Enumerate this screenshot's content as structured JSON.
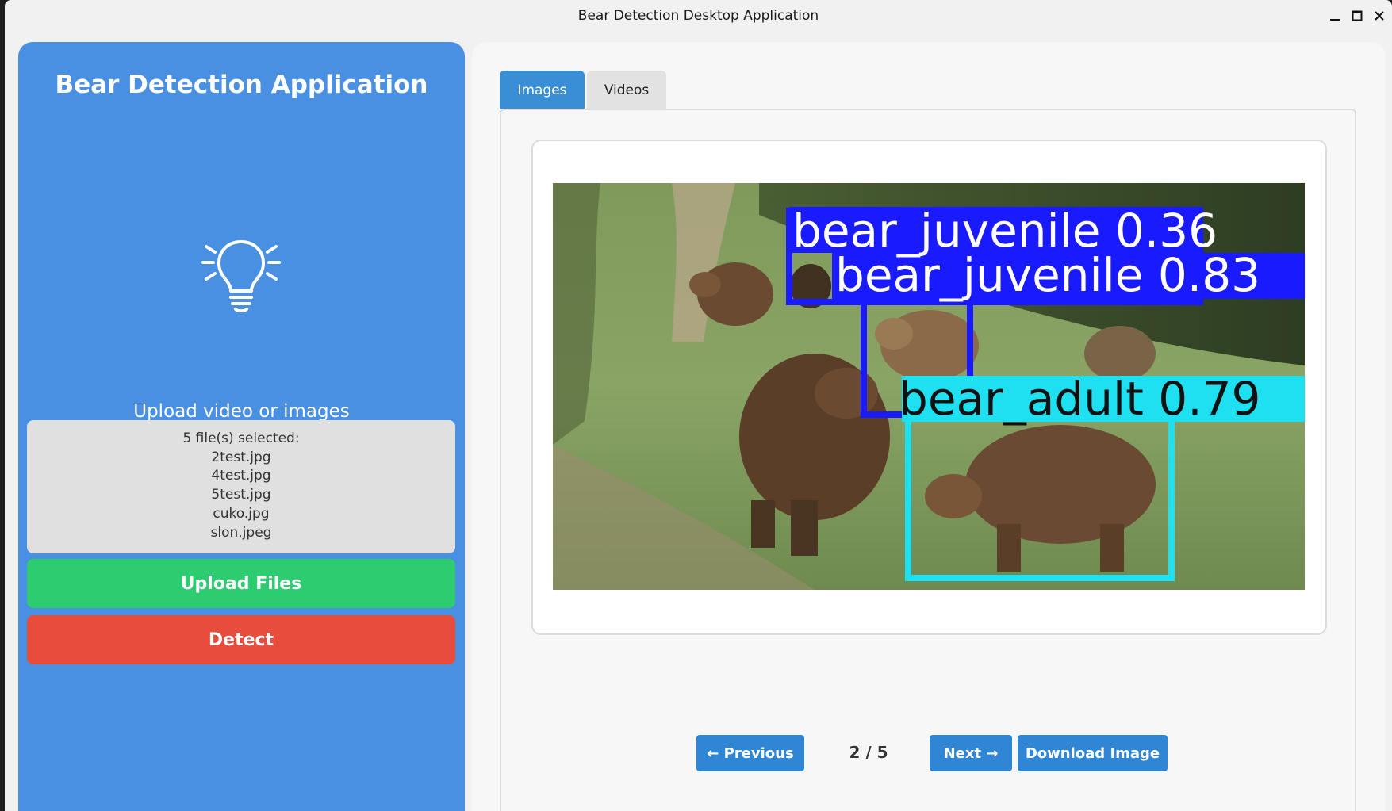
{
  "window": {
    "title": "Bear Detection Desktop Application"
  },
  "sidebar": {
    "heading": "Bear Detection Application",
    "icon": "lightbulb-icon",
    "upload_hint": "Upload video or images",
    "files": {
      "summary": "5 file(s) selected:",
      "names": [
        "2test.jpg",
        "4test.jpg",
        "5test.jpg",
        "cuko.jpg",
        "slon.jpeg"
      ]
    },
    "upload_button": "Upload Files",
    "detect_button": "Detect"
  },
  "tabs": [
    {
      "label": "Images",
      "active": true
    },
    {
      "label": "Videos",
      "active": false
    }
  ],
  "viewer": {
    "detections": [
      {
        "label": "bear_juvenile 0.36",
        "color": "#1a1aff"
      },
      {
        "label": "bear_juvenile 0.83",
        "color": "#1a1aff"
      },
      {
        "label": "bear_adult 0.79",
        "color": "#1ee0f0"
      }
    ],
    "prev_button": "← Previous",
    "page_counter": "2 / 5",
    "next_button": "Next →",
    "download_button": "Download Image"
  },
  "colors": {
    "sidebar": "#4a90e2",
    "upload": "#2ecc71",
    "detect": "#e74c3c",
    "accent": "#2f86d4"
  }
}
